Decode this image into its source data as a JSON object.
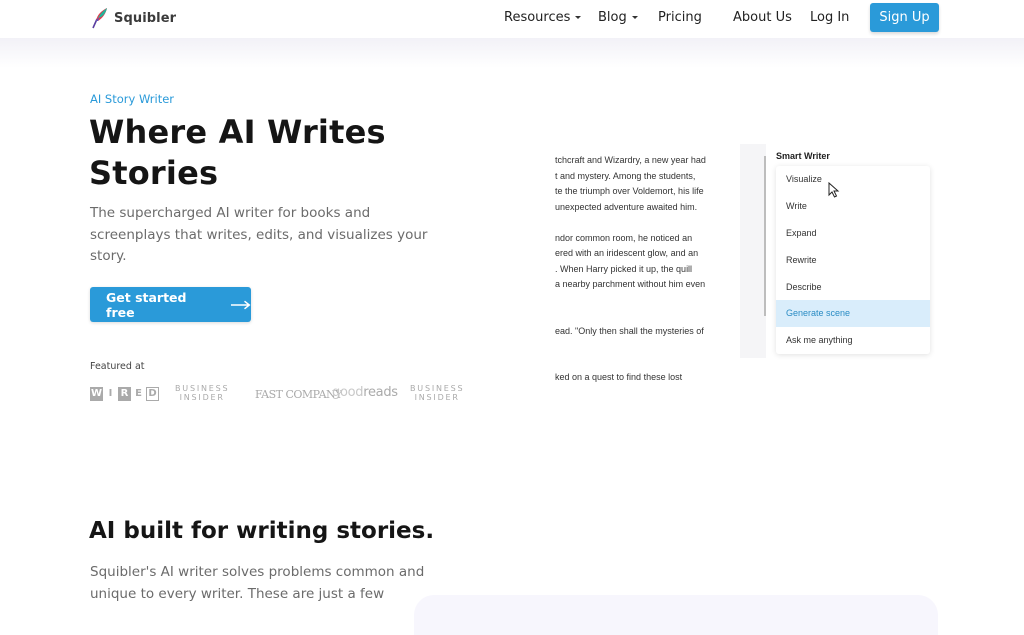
{
  "nav": {
    "brand": "Squibler",
    "links": [
      {
        "label": "Resources",
        "has_dropdown": true
      },
      {
        "label": "Blog",
        "has_dropdown": true
      },
      {
        "label": "Pricing",
        "has_dropdown": false
      },
      {
        "label": "About Us",
        "has_dropdown": false
      },
      {
        "label": "Log In",
        "has_dropdown": false
      }
    ],
    "signup_label": "Sign Up"
  },
  "hero": {
    "eyebrow": "AI Story Writer",
    "title_line1": "Where AI Writes",
    "title_line2": "Stories",
    "subtitle": "The supercharged AI writer for books and screenplays that writes, edits, and visualizes your story.",
    "cta_label": "Get started free",
    "cta_icon": "arrow-right-icon",
    "featured_label": "Featured at",
    "featured_logos": [
      "WIRED",
      "BUSINESS INSIDER",
      "FAST COMPANY",
      "goodreads",
      "BUSINESS INSIDER"
    ]
  },
  "demo": {
    "document_lines": [
      "tchcraft and Wizardry, a new year had",
      "t and mystery. Among the students,",
      "te the triumph over Voldemort, his life",
      "unexpected adventure awaited him.",
      "",
      "ndor common room, he noticed an",
      "ered with an iridescent glow, and an",
      ". When Harry picked it up, the quill",
      "a nearby parchment without him even",
      "",
      "",
      "ead. \"Only then shall the mysteries of",
      "",
      "",
      "ked on a quest to find these lost"
    ],
    "panel_title": "Smart Writer",
    "menu_items": [
      {
        "label": "Visualize",
        "active": false
      },
      {
        "label": "Write",
        "active": false
      },
      {
        "label": "Expand",
        "active": false
      },
      {
        "label": "Rewrite",
        "active": false
      },
      {
        "label": "Describe",
        "active": false
      },
      {
        "label": "Generate scene",
        "active": true
      },
      {
        "label": "Ask me anything",
        "active": false
      }
    ]
  },
  "section2": {
    "title": "AI built for writing stories.",
    "text": "Squibler's AI writer solves problems common and unique to every writer. These are just a few"
  },
  "colors": {
    "accent": "#2a9ad9",
    "active_menu_bg": "#d9edfb",
    "heading": "#151515",
    "body_text": "#6b6b6b"
  }
}
